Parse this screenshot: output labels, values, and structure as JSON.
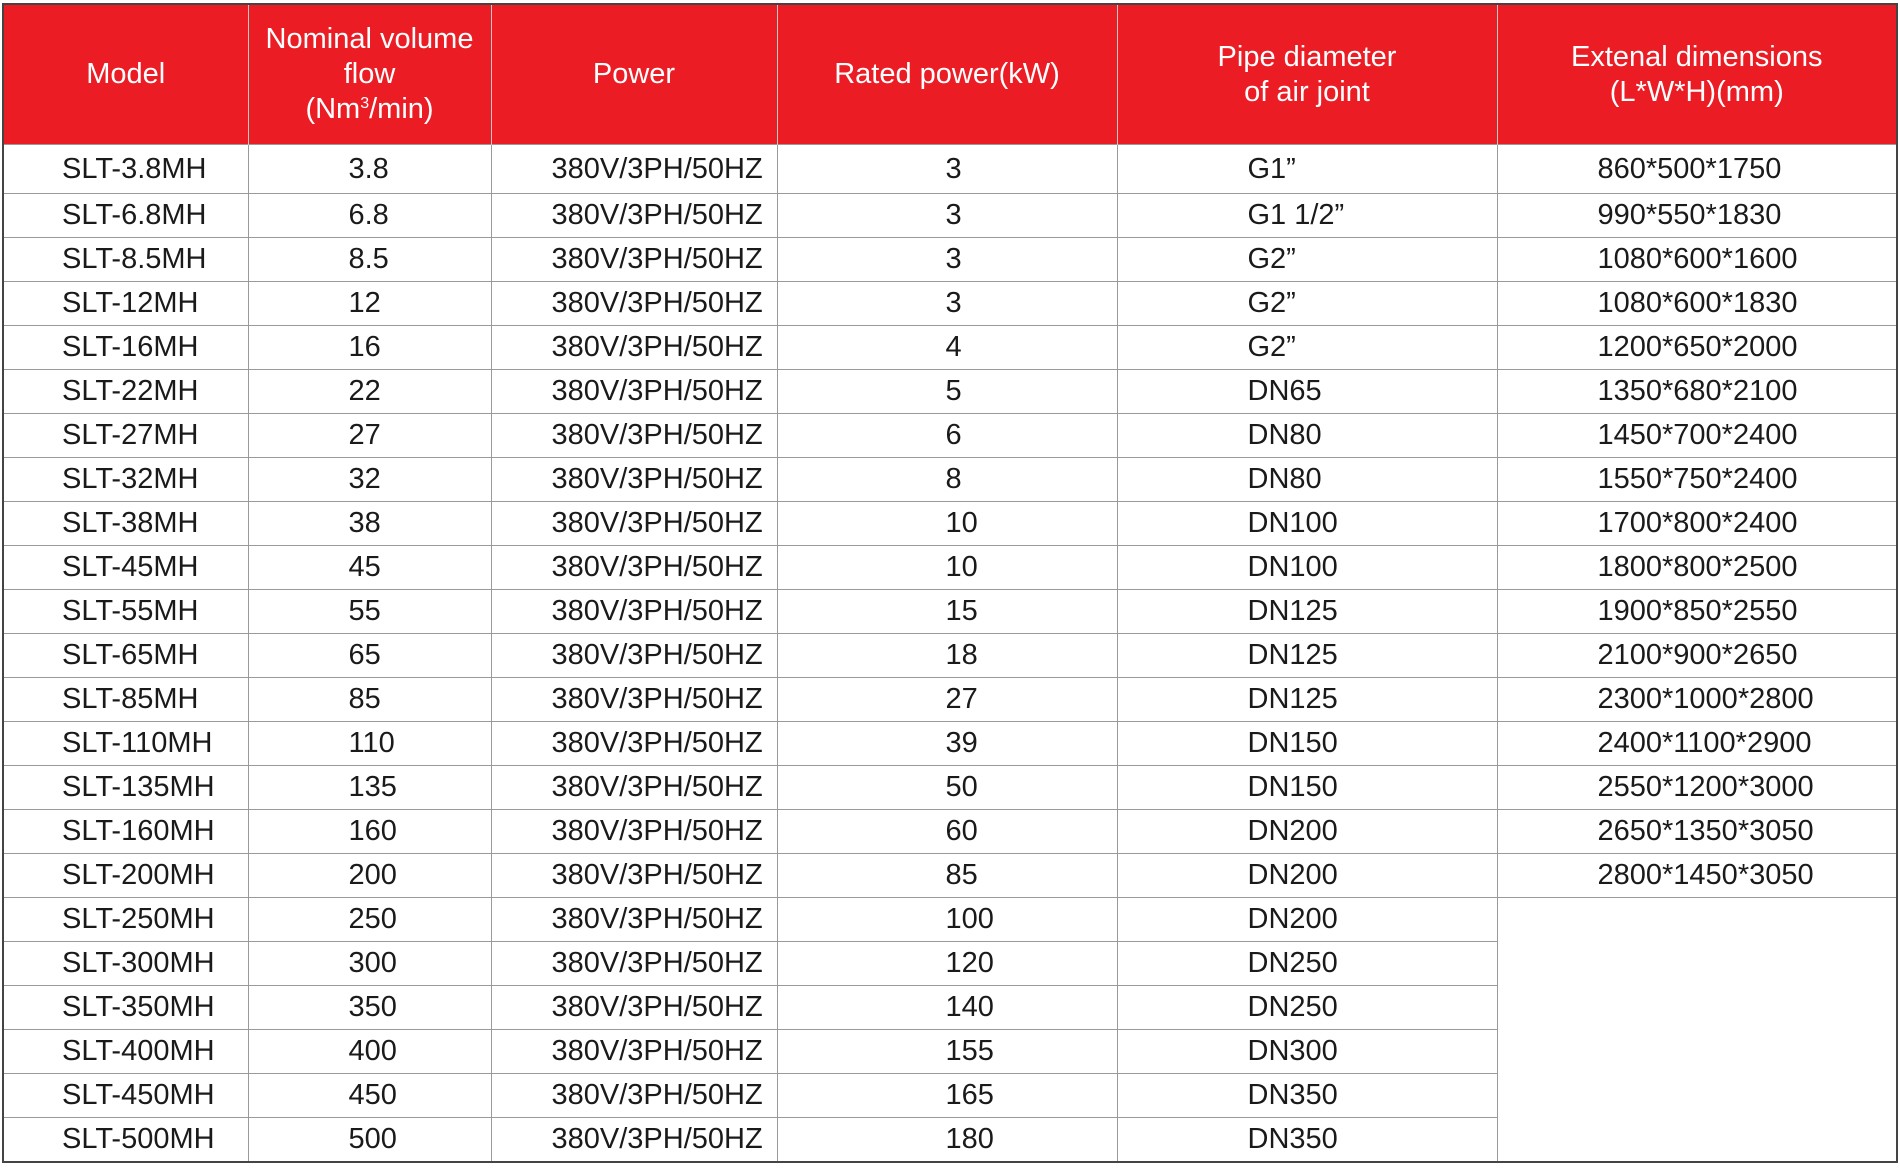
{
  "headers": {
    "model": "Model",
    "flow_line1": "Nominal volume",
    "flow_line2": "flow",
    "flow_unit_pre": "(Nm",
    "flow_unit_sup": "3",
    "flow_unit_post": "/min)",
    "power": "Power",
    "rated": "Rated power(kW)",
    "pipe_line1": "Pipe diameter",
    "pipe_line2": "of air joint",
    "dim_line1": "Extenal dimensions",
    "dim_line2": "(L*W*H)(mm)"
  },
  "colors": {
    "header_bg": "#ec1c24",
    "header_text": "#ffffff"
  },
  "rows": [
    {
      "model": "SLT-3.8MH",
      "flow": "3.8",
      "power": "380V/3PH/50HZ",
      "rated": "3",
      "pipe": "G1”",
      "dim": "860*500*1750"
    },
    {
      "model": "SLT-6.8MH",
      "flow": "6.8",
      "power": "380V/3PH/50HZ",
      "rated": "3",
      "pipe": "G1  1/2”",
      "dim": "990*550*1830"
    },
    {
      "model": "SLT-8.5MH",
      "flow": "8.5",
      "power": "380V/3PH/50HZ",
      "rated": "3",
      "pipe": "G2”",
      "dim": "1080*600*1600"
    },
    {
      "model": "SLT-12MH",
      "flow": "12",
      "power": "380V/3PH/50HZ",
      "rated": "3",
      "pipe": "G2”",
      "dim": "1080*600*1830"
    },
    {
      "model": "SLT-16MH",
      "flow": "16",
      "power": "380V/3PH/50HZ",
      "rated": "4",
      "pipe": "G2”",
      "dim": "1200*650*2000"
    },
    {
      "model": "SLT-22MH",
      "flow": "22",
      "power": "380V/3PH/50HZ",
      "rated": "5",
      "pipe": "DN65",
      "dim": "1350*680*2100"
    },
    {
      "model": "SLT-27MH",
      "flow": "27",
      "power": "380V/3PH/50HZ",
      "rated": "6",
      "pipe": "DN80",
      "dim": "1450*700*2400"
    },
    {
      "model": "SLT-32MH",
      "flow": "32",
      "power": "380V/3PH/50HZ",
      "rated": "8",
      "pipe": "DN80",
      "dim": "1550*750*2400"
    },
    {
      "model": "SLT-38MH",
      "flow": "38",
      "power": "380V/3PH/50HZ",
      "rated": "10",
      "pipe": "DN100",
      "dim": "1700*800*2400"
    },
    {
      "model": "SLT-45MH",
      "flow": "45",
      "power": "380V/3PH/50HZ",
      "rated": "10",
      "pipe": "DN100",
      "dim": "1800*800*2500"
    },
    {
      "model": "SLT-55MH",
      "flow": "55",
      "power": "380V/3PH/50HZ",
      "rated": "15",
      "pipe": "DN125",
      "dim": "1900*850*2550"
    },
    {
      "model": "SLT-65MH",
      "flow": "65",
      "power": "380V/3PH/50HZ",
      "rated": "18",
      "pipe": "DN125",
      "dim": "2100*900*2650"
    },
    {
      "model": "SLT-85MH",
      "flow": "85",
      "power": "380V/3PH/50HZ",
      "rated": "27",
      "pipe": "DN125",
      "dim": "2300*1000*2800"
    },
    {
      "model": "SLT-110MH",
      "flow": "110",
      "power": "380V/3PH/50HZ",
      "rated": "39",
      "pipe": "DN150",
      "dim": "2400*1100*2900"
    },
    {
      "model": "SLT-135MH",
      "flow": "135",
      "power": "380V/3PH/50HZ",
      "rated": "50",
      "pipe": "DN150",
      "dim": "2550*1200*3000"
    },
    {
      "model": "SLT-160MH",
      "flow": "160",
      "power": "380V/3PH/50HZ",
      "rated": "60",
      "pipe": "DN200",
      "dim": "2650*1350*3050"
    },
    {
      "model": "SLT-200MH",
      "flow": "200",
      "power": "380V/3PH/50HZ",
      "rated": "85",
      "pipe": "DN200",
      "dim": "2800*1450*3050"
    },
    {
      "model": "SLT-250MH",
      "flow": "250",
      "power": "380V/3PH/50HZ",
      "rated": "100",
      "pipe": "DN200",
      "dim": ""
    },
    {
      "model": "SLT-300MH",
      "flow": "300",
      "power": "380V/3PH/50HZ",
      "rated": "120",
      "pipe": "DN250",
      "dim": ""
    },
    {
      "model": "SLT-350MH",
      "flow": "350",
      "power": "380V/3PH/50HZ",
      "rated": "140",
      "pipe": "DN250",
      "dim": ""
    },
    {
      "model": "SLT-400MH",
      "flow": "400",
      "power": "380V/3PH/50HZ",
      "rated": "155",
      "pipe": "DN300",
      "dim": ""
    },
    {
      "model": "SLT-450MH",
      "flow": "450",
      "power": "380V/3PH/50HZ",
      "rated": "165",
      "pipe": "DN350",
      "dim": ""
    },
    {
      "model": "SLT-500MH",
      "flow": "500",
      "power": "380V/3PH/50HZ",
      "rated": "180",
      "pipe": "DN350",
      "dim": ""
    }
  ]
}
